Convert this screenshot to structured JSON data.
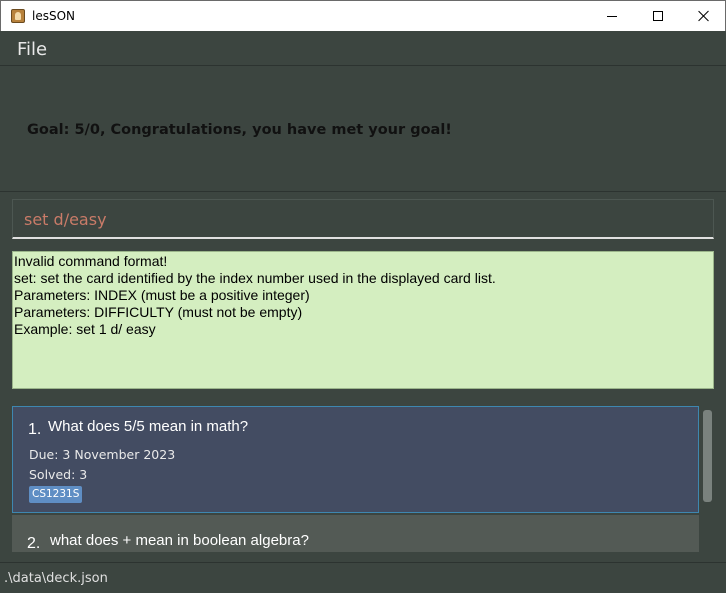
{
  "window": {
    "title": "lesSON",
    "icon": "app-icon"
  },
  "menu": {
    "file_label": "File"
  },
  "goal": {
    "text": "Goal: 5/0, Congratulations, you have met your goal!"
  },
  "command": {
    "value": "set d/easy"
  },
  "result": {
    "lines": [
      "Invalid command format!",
      "set: set the card identified by the index number used in the displayed card list.",
      "Parameters: INDEX (must be a positive integer)",
      "Parameters: DIFFICULTY (must not be empty)",
      "Example: set 1 d/ easy"
    ]
  },
  "cards": [
    {
      "index": "1.",
      "question": "What does 5/5 mean in math?",
      "due": "Due: 3 November 2023",
      "solved": "Solved: 3",
      "tag": "CS1231S"
    },
    {
      "index": "2.",
      "question": "what does + mean in boolean algebra?"
    }
  ],
  "status": {
    "path": ".\\data\\deck.json"
  },
  "colors": {
    "background": "#3c4540",
    "command_text": "#c97b68",
    "result_bg": "#d4eec0",
    "selected_card": "#434c62",
    "tag": "#5f8ec4"
  }
}
